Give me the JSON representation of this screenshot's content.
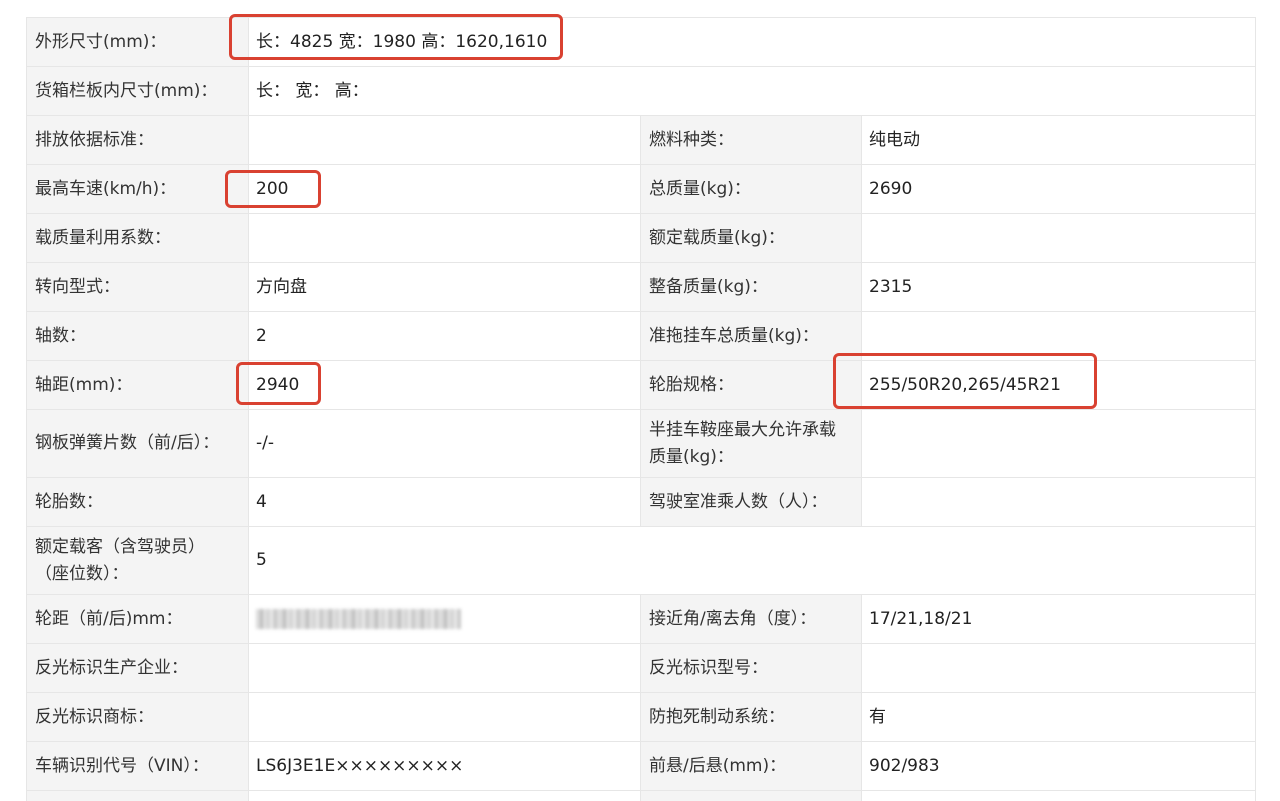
{
  "table": {
    "rows": [
      {
        "label": "外形尺寸(mm)：",
        "value": "长：4825 宽：1980 高：1620,1610"
      },
      {
        "label": "货箱栏板内尺寸(mm)：",
        "value": "长：  宽：  高："
      },
      {
        "left_label": "排放依据标准：",
        "left_value": "",
        "right_label": "燃料种类：",
        "right_value": "纯电动"
      },
      {
        "left_label": "最高车速(km/h)：",
        "left_value": "200",
        "right_label": "总质量(kg)：",
        "right_value": "2690"
      },
      {
        "left_label": "载质量利用系数：",
        "left_value": "",
        "right_label": "额定载质量(kg)：",
        "right_value": ""
      },
      {
        "left_label": "转向型式：",
        "left_value": "方向盘",
        "right_label": "整备质量(kg)：",
        "right_value": "2315"
      },
      {
        "left_label": "轴数：",
        "left_value": "2",
        "right_label": "准拖挂车总质量(kg)：",
        "right_value": ""
      },
      {
        "left_label": "轴距(mm)：",
        "left_value": "2940",
        "right_label": "轮胎规格：",
        "right_value": "255/50R20,265/45R21"
      },
      {
        "left_label": "钢板弹簧片数（前/后）：",
        "left_value": "-/-",
        "right_label_line1": "半挂车鞍座最大允许承载",
        "right_label_line2": "质量(kg)：",
        "right_value": ""
      },
      {
        "left_label": "轮胎数：",
        "left_value": "4",
        "right_label": "驾驶室准乘人数（人）：",
        "right_value": ""
      },
      {
        "label_line1": "额定载客（含驾驶员）",
        "label_line2": "（座位数）：",
        "value": "5"
      },
      {
        "left_label": "轮距（前/后)mm：",
        "left_value": "",
        "right_label": "接近角/离去角（度）：",
        "right_value": "17/21,18/21"
      },
      {
        "left_label": "反光标识生产企业：",
        "left_value": "",
        "right_label": "反光标识型号：",
        "right_value": ""
      },
      {
        "left_label": "反光标识商标：",
        "left_value": "",
        "right_label": "防抱死制动系统：",
        "right_value": "有"
      },
      {
        "left_label": "车辆识别代号（VIN）：",
        "left_value": "LS6J3E1E×××××××××",
        "right_label": "前悬/后悬(mm)：",
        "right_value": "902/983"
      }
    ]
  },
  "colors": {
    "label_bg": "#f4f4f4",
    "border": "#e6e6e6",
    "highlight": "#d94131"
  }
}
